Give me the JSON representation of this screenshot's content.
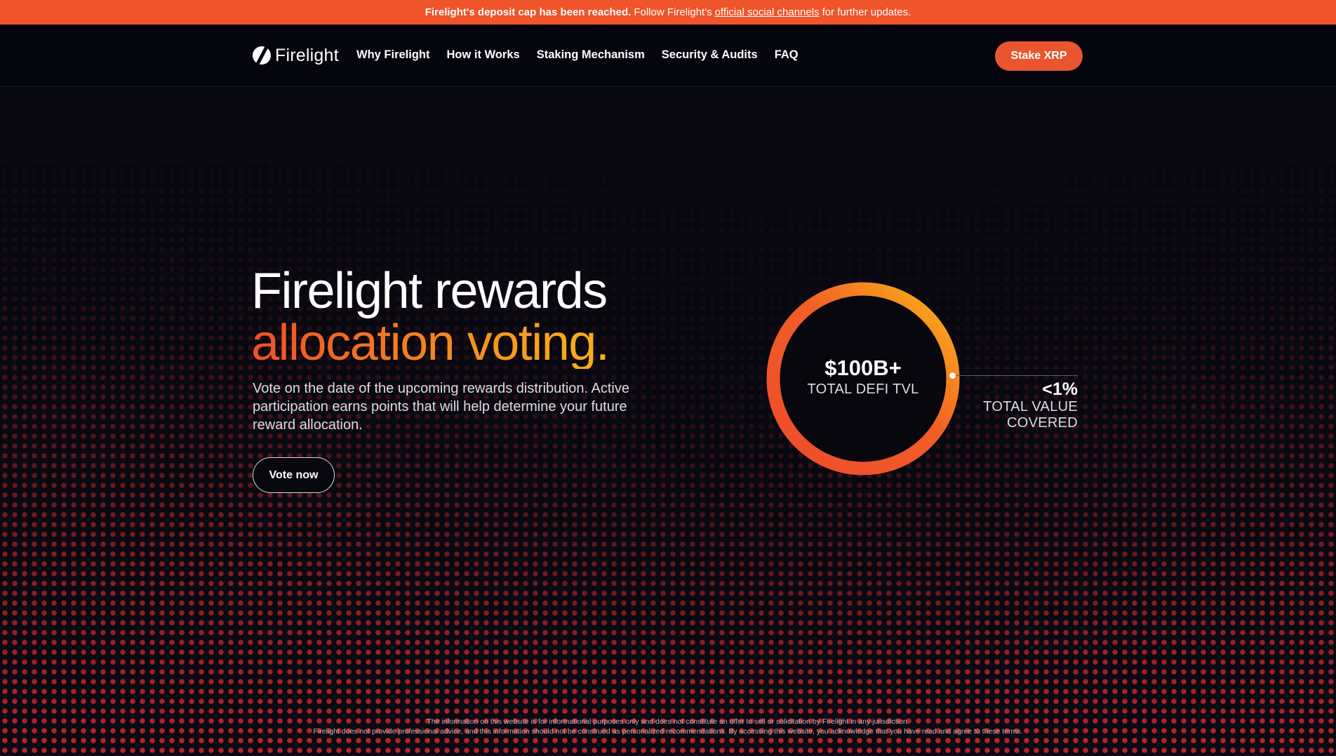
{
  "banner": {
    "strong_text": "Firelight's deposit cap has been reached.",
    "text_before_link": "Follow Firelight's",
    "link_text": "official social channels",
    "text_after_link": "for further updates.",
    "background": "#f0542a"
  },
  "nav": {
    "logo_text": "Firelight",
    "logo_icon": "firelight-logo-icon",
    "links": [
      "Why Firelight",
      "How it Works",
      "Staking Mechanism",
      "Security & Audits",
      "FAQ"
    ],
    "cta_label": "Stake XRP",
    "cta_color": "#e8552f"
  },
  "hero": {
    "headline_line1": "Firelight rewards",
    "headline_line2": "allocation voting.",
    "gradient_colors": [
      "#ee4f2a",
      "#f8b21a"
    ],
    "subtext": "Vote on the date of the upcoming rewards distribution. Active participation earns points that will help determine your future reward allocation.",
    "button_label": "Vote now"
  },
  "stats": {
    "main_value": "$100B+",
    "main_caption": "TOTAL DEFI TVL",
    "side_value": "<1%",
    "side_caption_line1": "TOTAL VALUE",
    "side_caption_line2": "COVERED"
  },
  "footer": {
    "disclaimer_line1": "The information on this website is for informational purposes only and does not constitute an offer to sell or solicitation by Firelight in any jurisdiction.",
    "disclaimer_line2": "Firelight does not provide professional advice, and this information should not be construed as personalized recommendations. By accessing this website, you acknowledge that you have read and agree to these terms."
  }
}
